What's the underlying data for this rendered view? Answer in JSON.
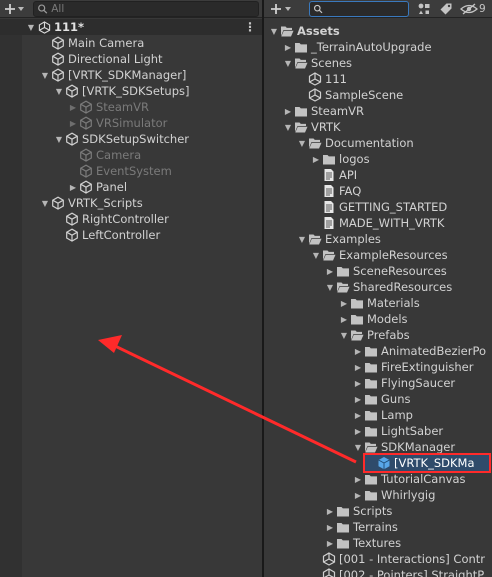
{
  "hierarchy": {
    "search_placeholder": "All",
    "scene": {
      "name": "111*"
    },
    "items": [
      {
        "label": "Main Camera",
        "depth": 1,
        "expand": "none",
        "icon": "gameobject-icon",
        "dim": false
      },
      {
        "label": "Directional Light",
        "depth": 1,
        "expand": "none",
        "icon": "gameobject-icon",
        "dim": false
      },
      {
        "label": "[VRTK_SDKManager]",
        "depth": 1,
        "expand": "open",
        "icon": "gameobject-icon",
        "dim": false
      },
      {
        "label": "[VRTK_SDKSetups]",
        "depth": 2,
        "expand": "open",
        "icon": "gameobject-icon",
        "dim": false
      },
      {
        "label": "SteamVR",
        "depth": 3,
        "expand": "closed",
        "icon": "gameobject-icon",
        "dim": true
      },
      {
        "label": "VRSimulator",
        "depth": 3,
        "expand": "closed",
        "icon": "gameobject-icon",
        "dim": true
      },
      {
        "label": "SDKSetupSwitcher",
        "depth": 2,
        "expand": "open",
        "icon": "gameobject-icon",
        "dim": false
      },
      {
        "label": "Camera",
        "depth": 3,
        "expand": "none",
        "icon": "gameobject-icon",
        "dim": true
      },
      {
        "label": "EventSystem",
        "depth": 3,
        "expand": "none",
        "icon": "gameobject-icon",
        "dim": true
      },
      {
        "label": "Panel",
        "depth": 3,
        "expand": "closed",
        "icon": "gameobject-icon",
        "dim": false
      },
      {
        "label": "VRTK_Scripts",
        "depth": 1,
        "expand": "open",
        "icon": "gameobject-icon",
        "dim": false
      },
      {
        "label": "RightController",
        "depth": 2,
        "expand": "none",
        "icon": "gameobject-icon",
        "dim": false
      },
      {
        "label": "LeftController",
        "depth": 2,
        "expand": "none",
        "icon": "gameobject-icon",
        "dim": false
      }
    ]
  },
  "project": {
    "search_value": "",
    "visibility_count": "9",
    "items": [
      {
        "label": "Assets",
        "depth": 0,
        "expand": "open",
        "icon": "folder-open-icon",
        "bold": true
      },
      {
        "label": "_TerrainAutoUpgrade",
        "depth": 1,
        "expand": "closed",
        "icon": "folder-icon"
      },
      {
        "label": "Scenes",
        "depth": 1,
        "expand": "open",
        "icon": "folder-open-icon"
      },
      {
        "label": "111",
        "depth": 2,
        "expand": "none",
        "icon": "unity-scene-icon"
      },
      {
        "label": "SampleScene",
        "depth": 2,
        "expand": "none",
        "icon": "unity-scene-icon"
      },
      {
        "label": "SteamVR",
        "depth": 1,
        "expand": "closed",
        "icon": "folder-icon"
      },
      {
        "label": "VRTK",
        "depth": 1,
        "expand": "open",
        "icon": "folder-open-icon"
      },
      {
        "label": "Documentation",
        "depth": 2,
        "expand": "open",
        "icon": "folder-open-icon"
      },
      {
        "label": "logos",
        "depth": 3,
        "expand": "closed",
        "icon": "folder-icon"
      },
      {
        "label": "API",
        "depth": 3,
        "expand": "none",
        "icon": "text-file-icon"
      },
      {
        "label": "FAQ",
        "depth": 3,
        "expand": "none",
        "icon": "text-file-icon"
      },
      {
        "label": "GETTING_STARTED",
        "depth": 3,
        "expand": "none",
        "icon": "text-file-icon"
      },
      {
        "label": "MADE_WITH_VRTK",
        "depth": 3,
        "expand": "none",
        "icon": "text-file-icon"
      },
      {
        "label": "Examples",
        "depth": 2,
        "expand": "open",
        "icon": "folder-open-icon"
      },
      {
        "label": "ExampleResources",
        "depth": 3,
        "expand": "open",
        "icon": "folder-open-icon"
      },
      {
        "label": "SceneResources",
        "depth": 4,
        "expand": "closed",
        "icon": "folder-icon"
      },
      {
        "label": "SharedResources",
        "depth": 4,
        "expand": "open",
        "icon": "folder-open-icon"
      },
      {
        "label": "Materials",
        "depth": 5,
        "expand": "closed",
        "icon": "folder-icon"
      },
      {
        "label": "Models",
        "depth": 5,
        "expand": "closed",
        "icon": "folder-icon"
      },
      {
        "label": "Prefabs",
        "depth": 5,
        "expand": "open",
        "icon": "folder-open-icon"
      },
      {
        "label": "AnimatedBezierPo",
        "depth": 6,
        "expand": "closed",
        "icon": "folder-icon"
      },
      {
        "label": "FireExtinguisher",
        "depth": 6,
        "expand": "closed",
        "icon": "folder-icon"
      },
      {
        "label": "FlyingSaucer",
        "depth": 6,
        "expand": "closed",
        "icon": "folder-icon"
      },
      {
        "label": "Guns",
        "depth": 6,
        "expand": "closed",
        "icon": "folder-icon"
      },
      {
        "label": "Lamp",
        "depth": 6,
        "expand": "closed",
        "icon": "folder-icon"
      },
      {
        "label": "LightSaber",
        "depth": 6,
        "expand": "closed",
        "icon": "folder-icon"
      },
      {
        "label": "SDKManager",
        "depth": 6,
        "expand": "open",
        "icon": "folder-open-icon"
      },
      {
        "label": "[VRTK_SDKMa",
        "depth": 7,
        "expand": "none",
        "icon": "prefab-icon",
        "highlighted": true
      },
      {
        "label": "TutorialCanvas",
        "depth": 6,
        "expand": "closed",
        "icon": "folder-icon"
      },
      {
        "label": "Whirlygig",
        "depth": 6,
        "expand": "closed",
        "icon": "folder-icon"
      },
      {
        "label": "Scripts",
        "depth": 4,
        "expand": "closed",
        "icon": "folder-icon"
      },
      {
        "label": "Terrains",
        "depth": 4,
        "expand": "closed",
        "icon": "folder-icon"
      },
      {
        "label": "Textures",
        "depth": 4,
        "expand": "closed",
        "icon": "folder-icon"
      },
      {
        "label": "[001 - Interactions] Contr",
        "depth": 3,
        "expand": "none",
        "icon": "unity-scene-icon"
      },
      {
        "label": "[002 - Pointers] StraightP",
        "depth": 3,
        "expand": "none",
        "icon": "unity-scene-icon"
      }
    ]
  },
  "annotation": {
    "color": "#ff2a2a"
  },
  "colors": {
    "folder": "#c2c2c2",
    "prefab": "#58a7e8",
    "highlight": "#2f4b6b"
  }
}
